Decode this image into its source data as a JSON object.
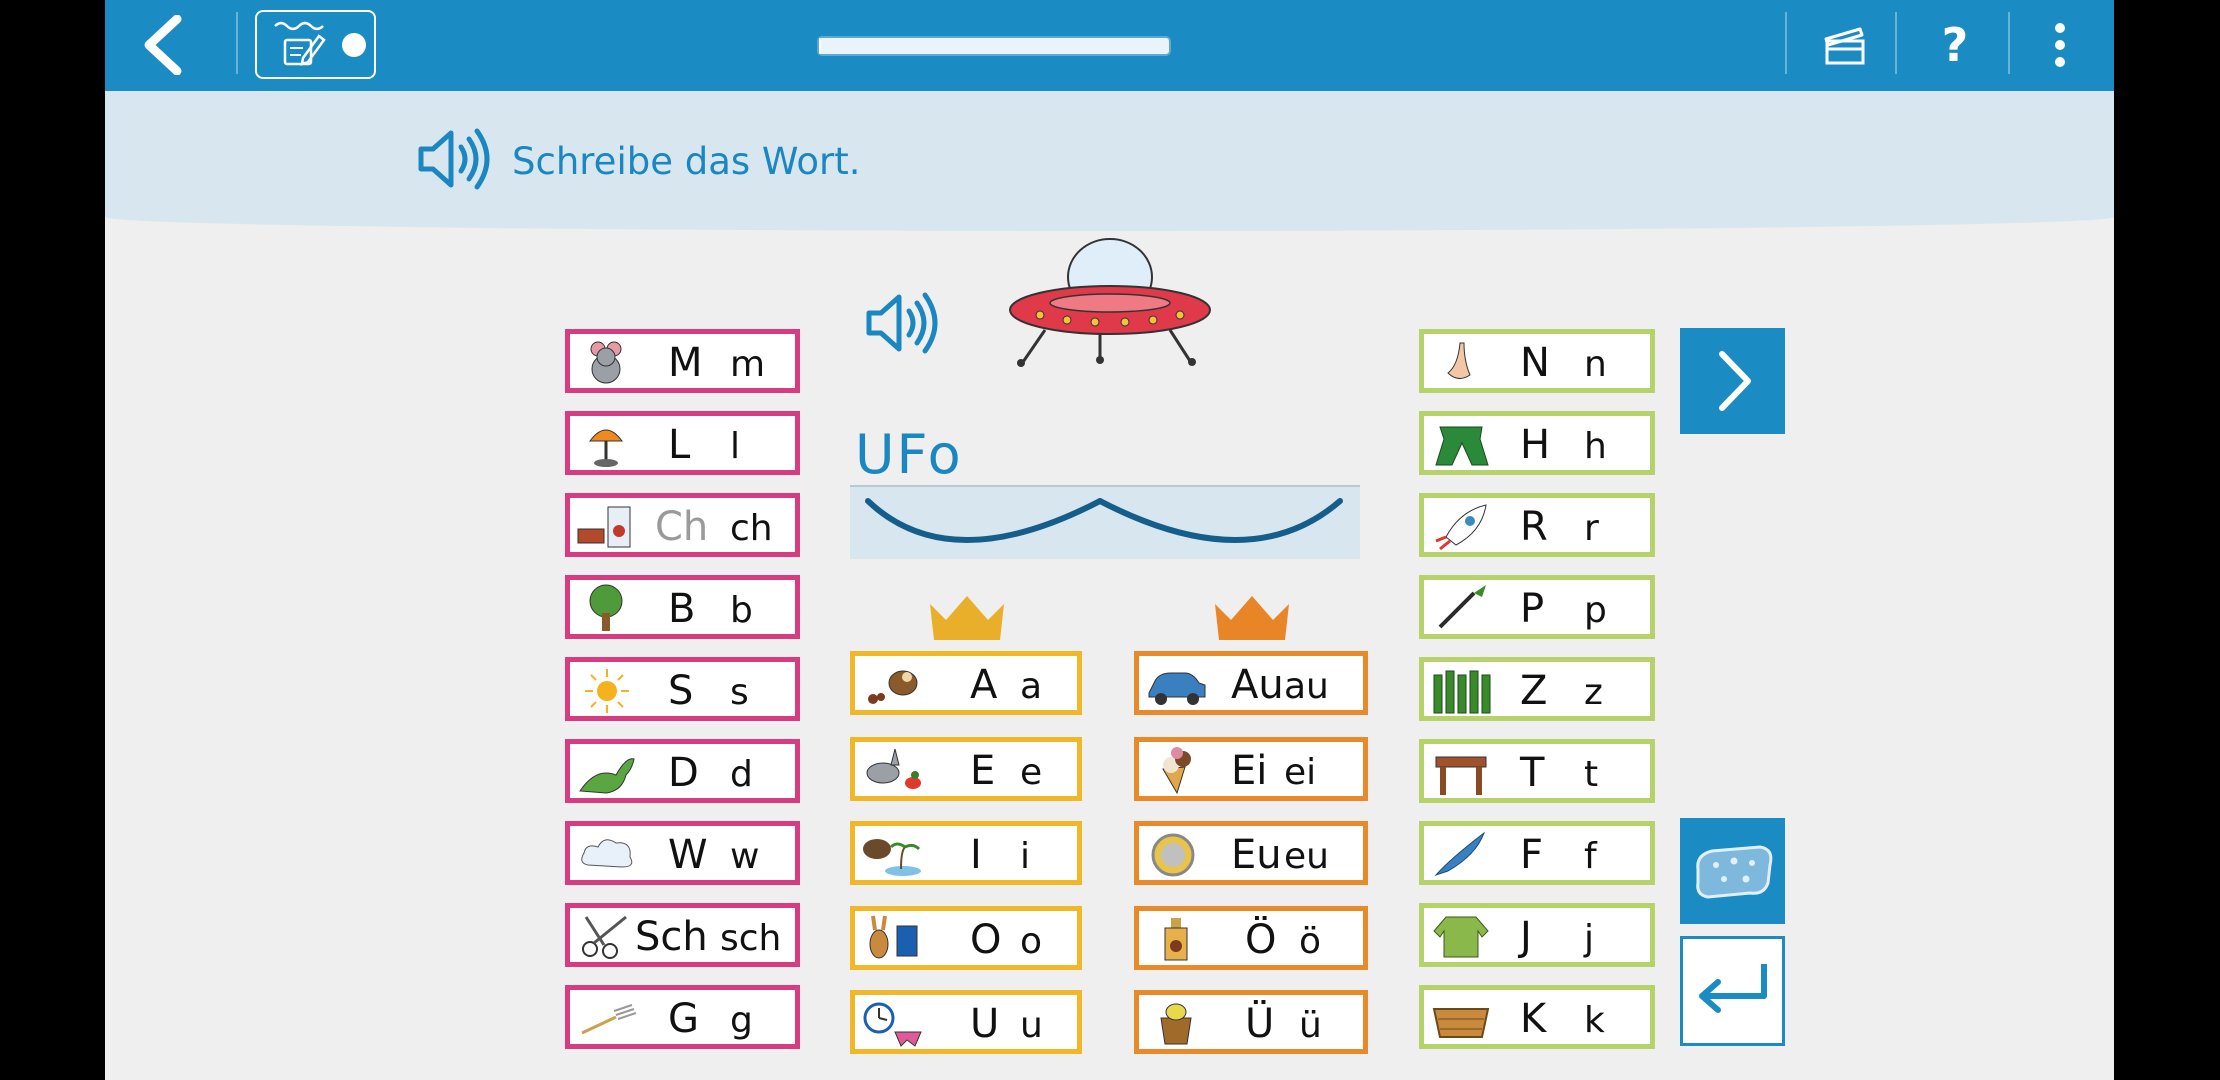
{
  "toolbar": {
    "back_icon": "back-arrow-icon",
    "mode_icon": "notebook-pencil-icon",
    "progress_fraction": 0.005,
    "clapper_icon": "clapperboard-icon",
    "help_label": "?",
    "menu_icon": "vertical-dots-icon"
  },
  "instruction": {
    "speaker_icon": "speaker-icon",
    "text": "Schreibe das Wort."
  },
  "task": {
    "speaker_icon": "speaker-icon",
    "picture": "ufo-image",
    "written_word": "UFo"
  },
  "consonants_left": [
    {
      "picture": "mouse-icon",
      "upper": "M",
      "lower": "m"
    },
    {
      "picture": "lamp-icon",
      "upper": "L",
      "lower": "l"
    },
    {
      "picture": "book-milk-icon",
      "upper": "Ch",
      "lower": "ch",
      "upper_dim": true
    },
    {
      "picture": "tree-icon",
      "upper": "B",
      "lower": "b"
    },
    {
      "picture": "sun-icon",
      "upper": "S",
      "lower": "s"
    },
    {
      "picture": "dinosaur-icon",
      "upper": "D",
      "lower": "d"
    },
    {
      "picture": "cloud-icon",
      "upper": "W",
      "lower": "w"
    },
    {
      "picture": "scissors-icon",
      "upper": "Sch",
      "lower": "sch"
    },
    {
      "picture": "fork-icon",
      "upper": "G",
      "lower": "g"
    }
  ],
  "vowels": [
    {
      "picture": "sloth-ant-icon",
      "upper": "A",
      "lower": "a"
    },
    {
      "picture": "donkey-duck-icon",
      "upper": "E",
      "lower": "e"
    },
    {
      "picture": "hedgehog-island-icon",
      "upper": "I",
      "lower": "i"
    },
    {
      "picture": "rabbit-folder-icon",
      "upper": "O",
      "lower": "o"
    },
    {
      "picture": "clock-underpants-icon",
      "upper": "U",
      "lower": "u"
    }
  ],
  "diphthongs": [
    {
      "picture": "car-icon",
      "upper": "Au",
      "lower": "au"
    },
    {
      "picture": "ice-cream-icon",
      "upper": "Ei",
      "lower": "ei"
    },
    {
      "picture": "euro-coin-icon",
      "upper": "Eu",
      "lower": "eu"
    },
    {
      "picture": "oil-bottle-icon",
      "upper": "Ö",
      "lower": "ö"
    },
    {
      "picture": "pot-icon",
      "upper": "Ü",
      "lower": "ü"
    }
  ],
  "consonants_right": [
    {
      "picture": "nose-icon",
      "upper": "N",
      "lower": "n"
    },
    {
      "picture": "trousers-icon",
      "upper": "H",
      "lower": "h"
    },
    {
      "picture": "rocket-icon",
      "upper": "R",
      "lower": "r"
    },
    {
      "picture": "paintbrush-icon",
      "upper": "P",
      "lower": "p"
    },
    {
      "picture": "fence-icon",
      "upper": "Z",
      "lower": "z"
    },
    {
      "picture": "table-icon",
      "upper": "T",
      "lower": "t"
    },
    {
      "picture": "feather-icon",
      "upper": "F",
      "lower": "f"
    },
    {
      "picture": "jacket-icon",
      "upper": "J",
      "lower": "j"
    },
    {
      "picture": "crate-icon",
      "upper": "K",
      "lower": "k"
    }
  ],
  "actions": {
    "next_icon": "chevron-right-icon",
    "eraser_icon": "sponge-icon",
    "enter_icon": "return-arrow-icon"
  },
  "colors": {
    "primary": "#1a8bc3",
    "pink": "#d83c80",
    "yellow": "#f0b829",
    "orange": "#e8892a",
    "green": "#b5d36a"
  }
}
